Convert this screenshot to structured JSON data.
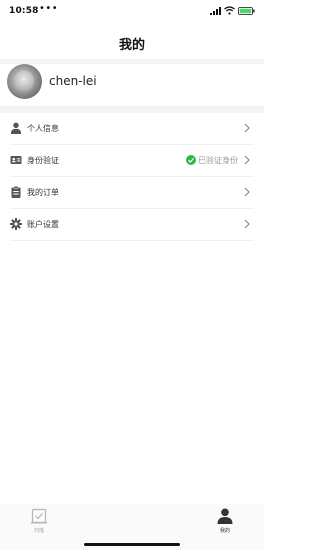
{
  "status_bar": {
    "time": "10:58",
    "dots": "•••"
  },
  "header": {
    "title": "我的"
  },
  "profile": {
    "username": "chen-lei"
  },
  "menu": {
    "items": [
      {
        "label": "个人信息",
        "icon": "person-icon"
      },
      {
        "label": "身份验证",
        "icon": "id-card-icon",
        "status": "已验证身份",
        "status_color": "#2eb84b"
      },
      {
        "label": "我的订单",
        "icon": "clipboard-icon"
      },
      {
        "label": "账户设置",
        "icon": "gear-icon"
      }
    ]
  },
  "tabs": [
    {
      "label": "扫描",
      "icon": "scan-icon",
      "active": false
    },
    {
      "label": "我的",
      "icon": "profile-icon",
      "active": true
    }
  ],
  "colors": {
    "accent": "#2eb84b",
    "icon": "#555555",
    "battery_fill": "#4cd964"
  }
}
